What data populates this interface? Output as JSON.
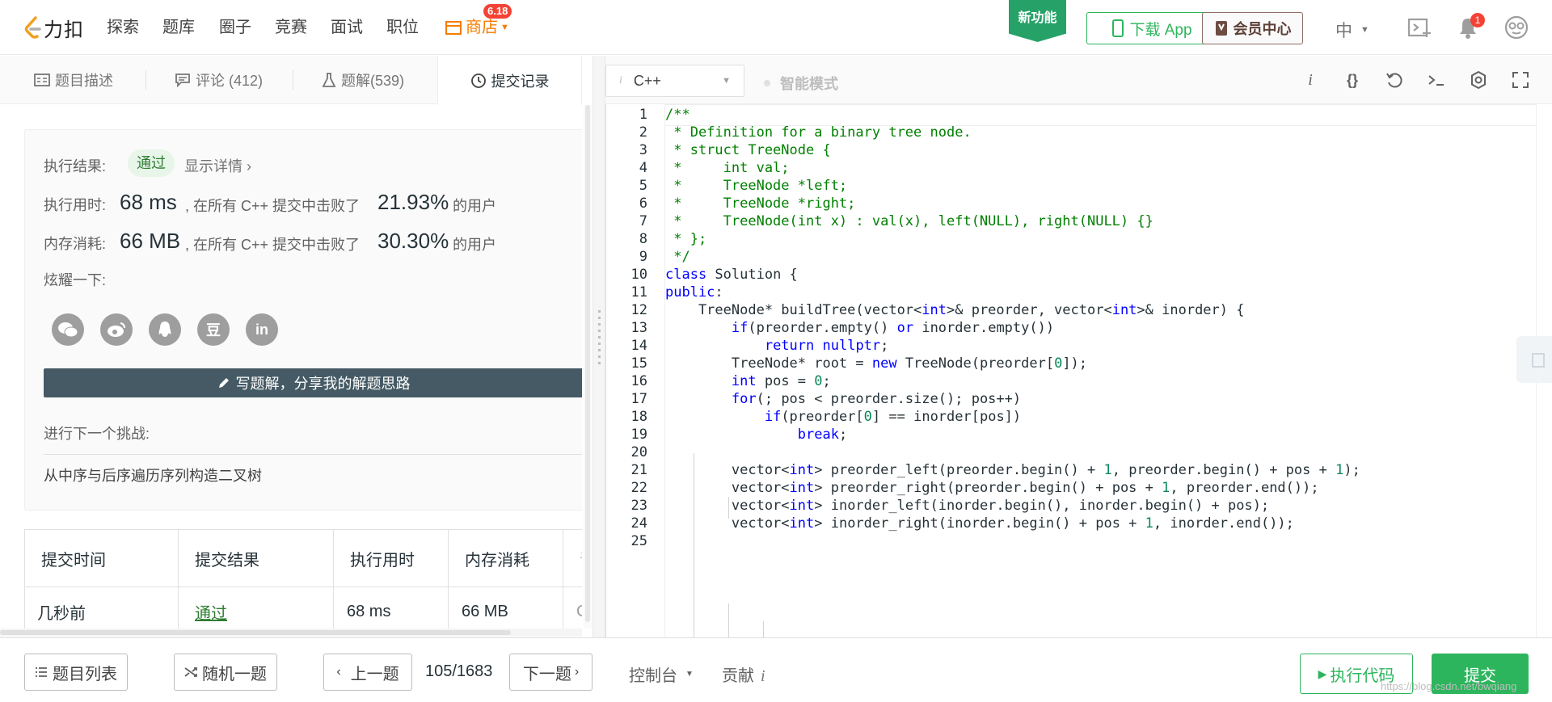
{
  "nav": {
    "logo_text": "力扣",
    "links": [
      "探索",
      "题库",
      "圈子",
      "竞赛",
      "面试",
      "职位"
    ],
    "store_label": "商店",
    "store_badge": "6.18",
    "new_feature": "新功能",
    "download_app": "下载 App",
    "member_center": "会员中心",
    "language": "中",
    "notification_count": "1",
    "accent_color": "#2db55d"
  },
  "left_tabs": [
    {
      "label": "题目描述",
      "icon": "document-icon"
    },
    {
      "label": "评论 (412)",
      "icon": "comment-icon"
    },
    {
      "label": "题解(539)",
      "icon": "flask-icon"
    },
    {
      "label": "提交记录",
      "icon": "clock-icon"
    }
  ],
  "result": {
    "label_result": "执行结果:",
    "status": "通过",
    "show_details": "显示详情",
    "label_time": "执行用时:",
    "time_value": "68 ms",
    "beat_prefix_time": ", 在所有 C++ 提交中击败了",
    "time_percent": "21.93%",
    "users_suffix": "的用户",
    "label_memory": "内存消耗:",
    "memory_value": "66 MB",
    "beat_prefix_memory": ", 在所有 C++ 提交中击败了",
    "memory_percent": "30.30%",
    "label_share": "炫耀一下:",
    "share_icons": [
      "wechat-icon",
      "weibo-icon",
      "qq-icon",
      "douban-icon",
      "linkedin-icon"
    ],
    "douban_glyph": "豆",
    "linkedin_glyph": "in",
    "write_solution": "写题解，分享我的解题思路",
    "next_challenge_label": "进行下一个挑战:",
    "next_problem": "从中序与后序遍历序列构造二叉树"
  },
  "submissions": {
    "headers": [
      "提交时间",
      "提交结果",
      "执行用时",
      "内存消耗",
      "语"
    ],
    "rows": [
      {
        "time": "几秒前",
        "result": "通过",
        "runtime": "68 ms",
        "memory": "66 MB",
        "lang": "C"
      }
    ]
  },
  "editor": {
    "language": "C++",
    "language_icon": "i",
    "smart_mode": "智能模式",
    "toolbar_icons": [
      "info-icon",
      "braces-icon",
      "reset-icon",
      "terminal-icon",
      "settings-icon",
      "fullscreen-icon"
    ],
    "lines": [
      "/**",
      " * Definition for a binary tree node.",
      " * struct TreeNode {",
      " *     int val;",
      " *     TreeNode *left;",
      " *     TreeNode *right;",
      " *     TreeNode(int x) : val(x), left(NULL), right(NULL) {}",
      " * };",
      " */",
      "class Solution {",
      "public:",
      "    TreeNode* buildTree(vector<int>& preorder, vector<int>& inorder) {",
      "        if(preorder.empty() or inorder.empty())",
      "            return nullptr;",
      "        TreeNode* root = new TreeNode(preorder[0]);",
      "        int pos = 0;",
      "        for(; pos < preorder.size(); pos++)",
      "            if(preorder[0] == inorder[pos])",
      "                break;",
      "",
      "        vector<int> preorder_left(preorder.begin() + 1, preorder.begin() + pos + 1);",
      "        vector<int> preorder_right(preorder.begin() + pos + 1, preorder.end());",
      "        vector<int> inorder_left(inorder.begin(), inorder.begin() + pos);",
      "        vector<int> inorder_right(inorder.begin() + pos + 1, inorder.end());",
      ""
    ]
  },
  "bottom": {
    "problem_list": "题目列表",
    "random": "随机一题",
    "prev": "上一题",
    "page": "105/1683",
    "next": "下一题",
    "console": "控制台",
    "contribute": "贡献",
    "contribute_icon": "i",
    "run_code": "执行代码",
    "submit": "提交",
    "watermark": "https://blog.csdn.net/bwqiang"
  }
}
